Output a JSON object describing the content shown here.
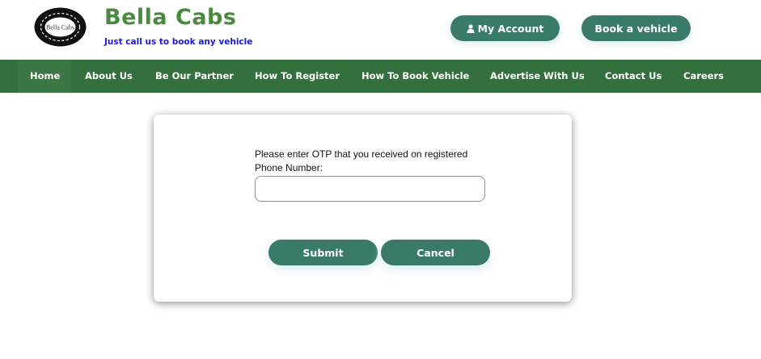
{
  "header": {
    "logo_text": "Bella Cabs",
    "brand_name": "Bella Cabs",
    "tagline": "Just call us to book any vehicle",
    "account_button": "My Account",
    "account_icon": "user-icon",
    "book_button": "Book a vehicle"
  },
  "nav": {
    "items": [
      {
        "label": "Home",
        "active": true
      },
      {
        "label": "About Us"
      },
      {
        "label": "Be Our Partner"
      },
      {
        "label": "How To Register"
      },
      {
        "label": "How To Book Vehicle"
      },
      {
        "label": "Advertise With Us"
      },
      {
        "label": "Contact Us"
      },
      {
        "label": "Careers"
      }
    ]
  },
  "otp_form": {
    "label": "Please enter OTP that you received on registered Phone Number:",
    "input_value": "",
    "submit_label": "Submit",
    "cancel_label": "Cancel"
  },
  "colors": {
    "brand_green": "#4a8a3e",
    "nav_green": "#34703e",
    "button_teal": "#3a7a68",
    "tagline_blue": "#1a1ad8"
  }
}
